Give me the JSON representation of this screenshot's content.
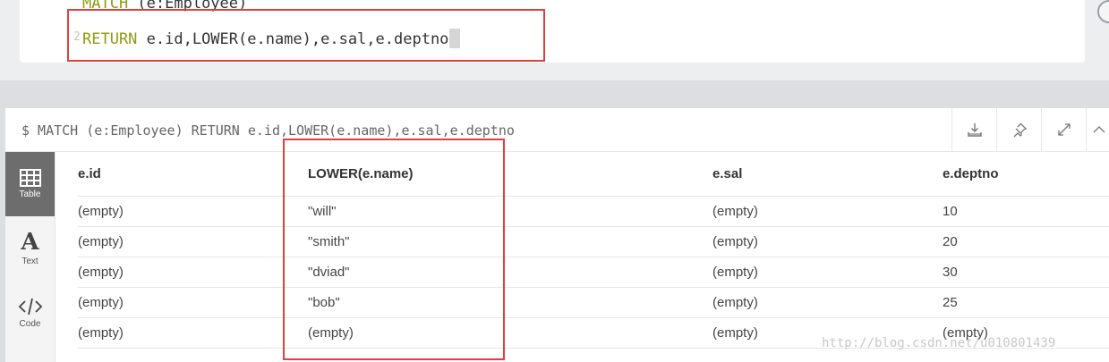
{
  "editor": {
    "line1_keyword": "MATCH",
    "line1_rest": " (e:Employee)",
    "line2_keyword": "RETURN",
    "line2_rest": " e.id,LOWER(e.name),e.sal,e.deptno",
    "line2_number": "2"
  },
  "frame": {
    "title": "$ MATCH (e:Employee) RETURN e.id,LOWER(e.name),e.sal,e.deptno",
    "actions": [
      "download-icon",
      "pin-icon",
      "expand-icon",
      "collapse-icon"
    ]
  },
  "sidebar": {
    "items": [
      {
        "label": "Table",
        "icon": "table-icon",
        "active": true
      },
      {
        "label": "Text",
        "icon": "text-icon",
        "active": false
      },
      {
        "label": "Code",
        "icon": "code-icon",
        "active": false
      }
    ]
  },
  "table": {
    "columns": [
      "e.id",
      "LOWER(e.name)",
      "e.sal",
      "e.deptno"
    ],
    "rows": [
      [
        "(empty)",
        "\"will\"",
        "(empty)",
        "10"
      ],
      [
        "(empty)",
        "\"smith\"",
        "(empty)",
        "20"
      ],
      [
        "(empty)",
        "\"dviad\"",
        "(empty)",
        "30"
      ],
      [
        "(empty)",
        "\"bob\"",
        "(empty)",
        "25"
      ],
      [
        "(empty)",
        "(empty)",
        "(empty)",
        "(empty)"
      ]
    ]
  },
  "watermark": "http://blog.csdn.net/u010801439",
  "colors": {
    "keyword": "#8f9c12",
    "highlight_box": "#e53e3e",
    "active_tab": "#6d6d6d"
  }
}
